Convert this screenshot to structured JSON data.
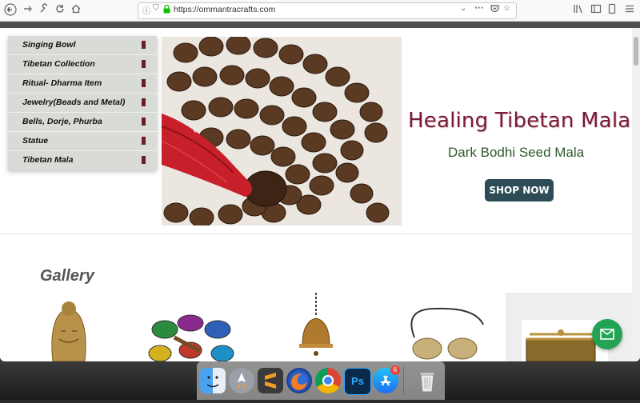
{
  "browser": {
    "url": "https://ommantracrafts.com",
    "icons": [
      "back-icon",
      "forward-icon",
      "tools-icon",
      "reload-icon",
      "home-icon",
      "info-icon",
      "tracking-protection-icon",
      "lock-icon",
      "dropdown-icon",
      "more-icon",
      "pocket-icon",
      "bookmark-star-icon",
      "library-icon",
      "sidebar-icon",
      "reader-icon",
      "menu-icon"
    ]
  },
  "menu": {
    "items": [
      {
        "label": "Singing Bowl"
      },
      {
        "label": "Tibetan Collection"
      },
      {
        "label": "Ritual- Dharma Item"
      },
      {
        "label": "Jewelry(Beads and Metal)"
      },
      {
        "label": "Bells, Dorje, Phurba"
      },
      {
        "label": "Statue"
      },
      {
        "label": "Tibetan Mala"
      }
    ],
    "arrow_color": "#6b1d26"
  },
  "hero": {
    "title": "Healing Tibetan Mala",
    "subtitle": "Dark Bodhi Seed Mala",
    "button": "SHOP NOW",
    "title_color": "#7a1a35",
    "subtitle_color": "#2e5a2a",
    "button_color": "#2d4c55"
  },
  "gallery": {
    "title": "Gallery"
  },
  "dock": {
    "apps": [
      "Finder",
      "Launchpad",
      "Sublime Text",
      "Firefox",
      "Chrome",
      "Photoshop",
      "App Store",
      "Trash"
    ],
    "ps_label": "Ps",
    "appstore_badge": "6"
  }
}
